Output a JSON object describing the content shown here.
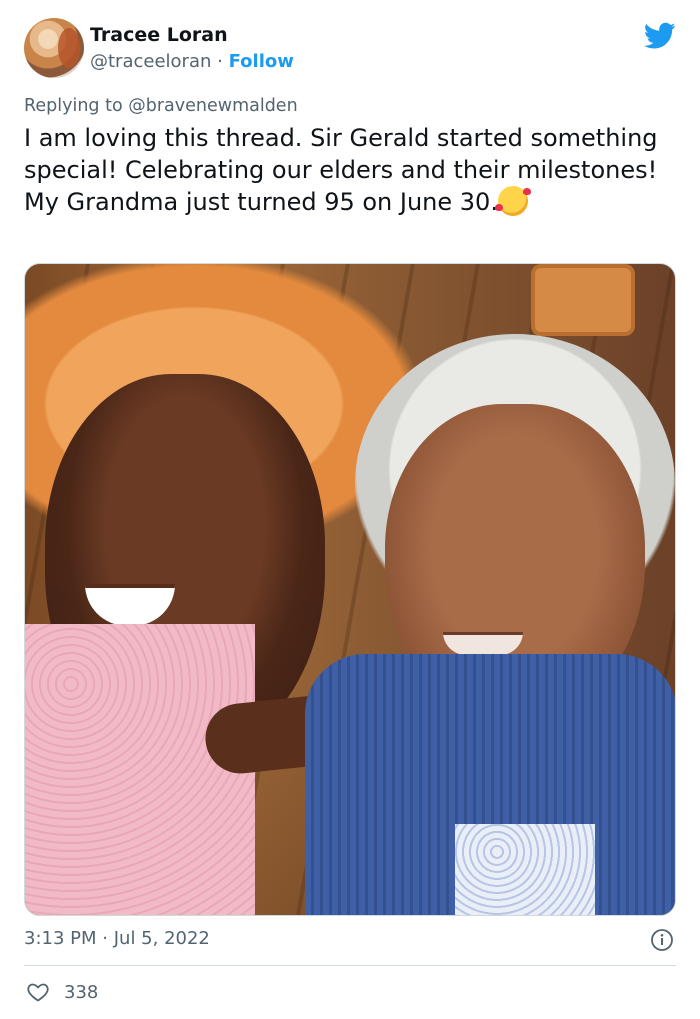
{
  "author": {
    "name": "Tracee Loran",
    "handle": "@traceeloran",
    "separator": "·",
    "follow_label": "Follow"
  },
  "reply": {
    "prefix": "Replying to",
    "handle": "@bravenewmalden"
  },
  "tweet": {
    "text": "I am loving this thread. Sir Gerald started something special! Celebrating our elders and their milestones! My Grandma just turned 95 on June 30."
  },
  "meta": {
    "time": "3:13 PM",
    "separator": "·",
    "date": "Jul 5, 2022"
  },
  "engagement": {
    "likes": "338"
  },
  "colors": {
    "accent": "#1d9bf0",
    "secondary_text": "#536471",
    "divider": "#cfd9de"
  },
  "icons": {
    "brand": "twitter-bird-icon",
    "info": "info-icon",
    "like": "heart-icon",
    "emoji": "smiling-face-with-hearts-emoji"
  }
}
